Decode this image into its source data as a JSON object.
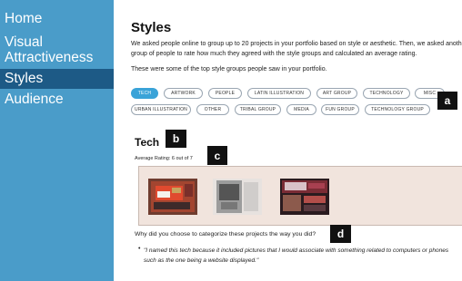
{
  "nav": {
    "items": [
      {
        "label": "Home"
      },
      {
        "label": "Visual"
      },
      {
        "label": "Attractiveness"
      },
      {
        "label": "Styles"
      },
      {
        "label": "Audience"
      }
    ]
  },
  "page": {
    "title": "Styles",
    "intro_line1": "We asked people online to group up to 20 projects in your portfolio based on style or aesthetic. Then, we asked another",
    "intro_line2": "group of people to rate how much they agreed with the style groups and calculated an average rating.",
    "intro_line3": "These were some of the top style groups people saw in your portfolio."
  },
  "style_groups": [
    "TECH",
    "ARTWORK",
    "PEOPLE",
    "LATIN ILLUSTRATION",
    "ART GROUP",
    "TECHNOLOGY",
    "MISC",
    "URBAN ILLUSTRATION",
    "OTHER",
    "TRIBAL GROUP",
    "MEDIA",
    "FUN GROUP",
    "TECHNOLOGY GROUP"
  ],
  "selected_group": {
    "name": "Tech",
    "average_rating": "Average Rating: 6 out of 7",
    "question": "Why did you choose to categorize these projects the way you did?",
    "quote": "\"I named this tech because it included pictures that I would associate with something related to computers or phones such as the one being a website displayed.\""
  },
  "annotations": {
    "a": "a",
    "b": "b",
    "c": "c",
    "d": "d"
  },
  "colors": {
    "sidebar": "#4a9cc9",
    "sidebar_active": "#1d5a86",
    "pill_active": "#3aa3d8",
    "gallery_bg": "#f1e4dd"
  }
}
